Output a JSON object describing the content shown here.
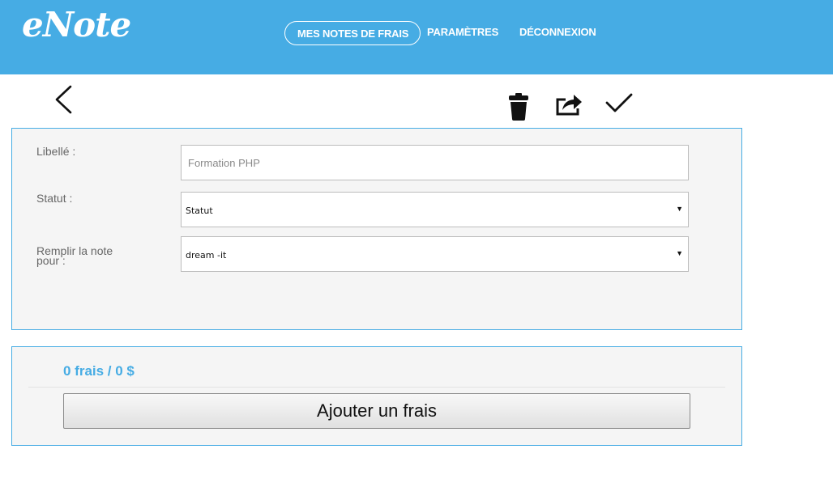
{
  "app": {
    "logo_text": "eNote"
  },
  "nav": {
    "items": [
      {
        "label": "MES NOTES DE FRAIS",
        "active": true
      },
      {
        "label": "PARAMÈTRES",
        "active": false
      },
      {
        "label": "DÉCONNEXION",
        "active": false
      }
    ]
  },
  "toolbar": {
    "icons": [
      "back-icon",
      "trash-icon",
      "share-icon",
      "check-icon"
    ]
  },
  "form": {
    "libelle_label": "Libellé :",
    "libelle_placeholder": "Formation PHP",
    "libelle_value": "",
    "statut_label": "Statut :",
    "statut_value": "Statut",
    "remplir_label_line1": "Remplir la note",
    "remplir_label_line2": "pour :",
    "remplir_value": "dream -it"
  },
  "fees": {
    "summary": "0 frais / 0 $",
    "add_button_label": "Ajouter un frais"
  },
  "colors": {
    "header_bg": "#46ace4",
    "accent": "#46ace4",
    "panel_bg": "#f5f5f5"
  }
}
